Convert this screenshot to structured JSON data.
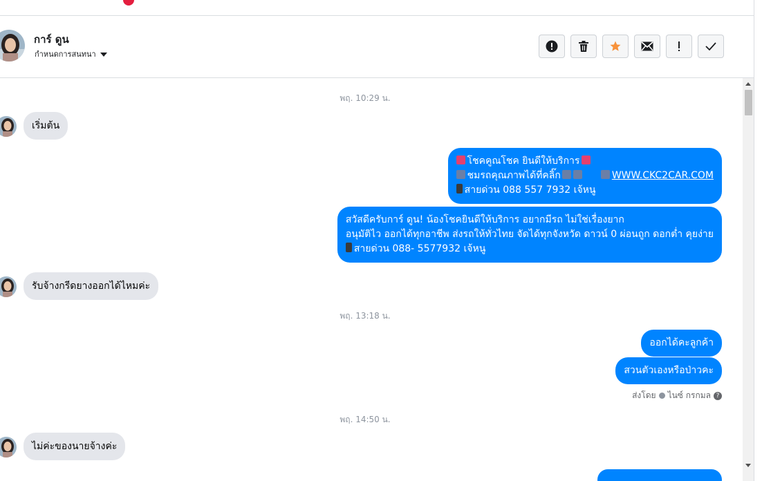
{
  "contact": {
    "name": "การ์ ดูน",
    "subtitle": "กำหนดการสนทนา"
  },
  "actions": [
    {
      "name": "mark-spam-button",
      "icon": "alert-circle-icon"
    },
    {
      "name": "delete-button",
      "icon": "trash-icon"
    },
    {
      "name": "star-button",
      "icon": "star-icon",
      "color": "#f7923b"
    },
    {
      "name": "mark-unread-button",
      "icon": "envelope-icon"
    },
    {
      "name": "priority-button",
      "icon": "exclamation-icon"
    },
    {
      "name": "mark-done-button",
      "icon": "checkmark-icon"
    }
  ],
  "colors": {
    "outgoing_bubble": "#0084ff",
    "incoming_bubble": "#e4e6eb",
    "timestamp": "#8d949e"
  },
  "messages": {
    "ts1": "พฤ. 10:29 น.",
    "in1": "เริ่มต้น",
    "out1_line1": "โชคคูณโชค ยินดีให้บริการ",
    "out1_line2": "ชมรถคุณภาพได้ที่คลิ๊ก",
    "out1_link": "WWW.CKC2CAR.COM",
    "out1_line3": "สายด่วน 088 557 7932 เจ้หนู",
    "out2_line1": "สวัสดีครับการ์ ดูน! น้องโชคยินดีให้บริการ อยากมีรถ ไม่ใช่เรื่องยาก",
    "out2_line2": "อนุมัติไว ออกได้ทุกอาชีพ ส่งรถให้ทั่วไทย จัดได้ทุกจังหวัด ดาวน์ 0  ผ่อนถูก ดอกต่ำ คุยง่าย",
    "out2_line3": "สายด่วน 088- 5577932 เจ้หนู",
    "in2": "รับจ้างกรีดยางออกได้ไหมค่ะ",
    "ts2": "พฤ. 13:18 น.",
    "out3": "ออกได้คะลูกค้า",
    "out4": "สวนตัวเองหรือป่าวคะ",
    "sent_by_label": "ส่งโดย",
    "sent_by_name": "ไนซ์ กรกมล",
    "ts3": "พฤ. 14:50 น.",
    "in3": "ไม่ค่ะของนายจ้างค่ะ"
  }
}
